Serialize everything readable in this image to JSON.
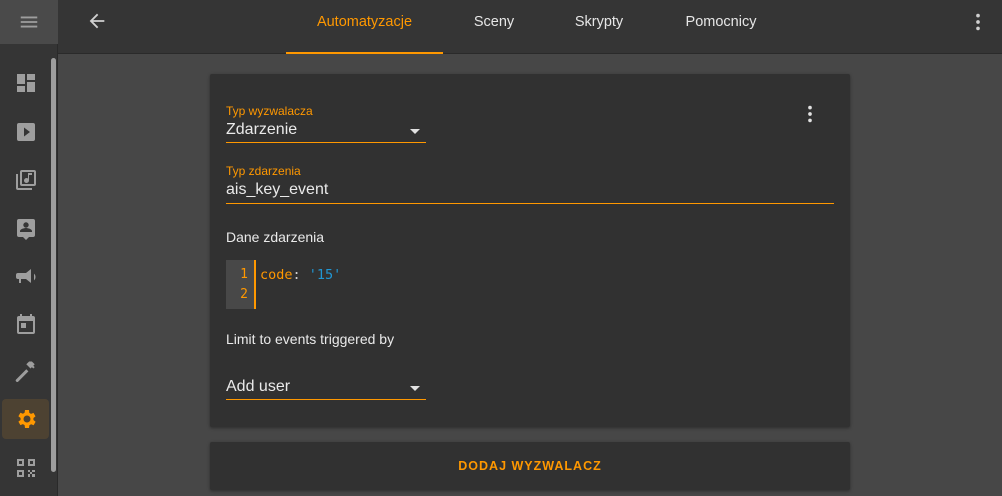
{
  "topbar": {
    "tabs": [
      {
        "label": "Automatyzacje",
        "active": true
      },
      {
        "label": "Sceny",
        "active": false
      },
      {
        "label": "Skrypty",
        "active": false
      },
      {
        "label": "Pomocnicy",
        "active": false
      }
    ]
  },
  "sidebar": {
    "items": [
      {
        "icon": "dashboard-icon"
      },
      {
        "icon": "play-icon"
      },
      {
        "icon": "media-library-icon"
      },
      {
        "icon": "contact-icon"
      },
      {
        "icon": "megaphone-icon"
      },
      {
        "icon": "calendar-icon"
      },
      {
        "icon": "hammer-icon"
      },
      {
        "icon": "gear-icon",
        "active": true
      },
      {
        "icon": "qrcode-icon"
      }
    ]
  },
  "trigger": {
    "trigger_type_label": "Typ wyzwalacza",
    "trigger_type_value": "Zdarzenie",
    "event_type_label": "Typ zdarzenia",
    "event_type_value": "ais_key_event",
    "event_data_label": "Dane zdarzenia",
    "code": {
      "line_numbers": [
        "1",
        "2"
      ],
      "key": "code",
      "separator": ": ",
      "value": "'15'"
    },
    "limit_label": "Limit to events triggered by",
    "user_select_value": "Add user"
  },
  "add_trigger_label": "DODAJ WYZWALACZ",
  "colors": {
    "accent": "#ff9800",
    "background": "#474747",
    "card": "#313131",
    "bar": "#353535",
    "code_string": "#2196d3"
  }
}
